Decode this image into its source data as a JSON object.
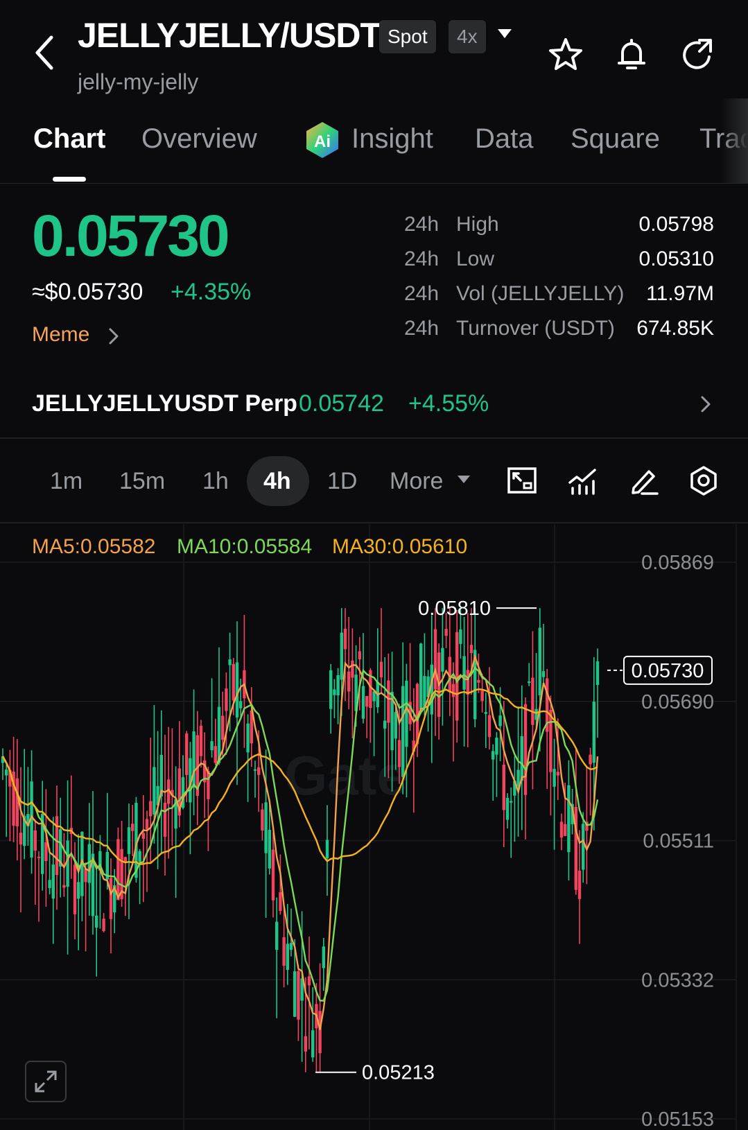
{
  "header": {
    "pair": "JELLYJELLY/USDT",
    "spot_badge": "Spot",
    "leverage_badge": "4x",
    "subtitle": "jelly-my-jelly"
  },
  "tabs": [
    {
      "label": "Chart"
    },
    {
      "label": "Overview"
    },
    {
      "label": "Insight"
    },
    {
      "label": "Data"
    },
    {
      "label": "Square"
    },
    {
      "label": "Trac"
    }
  ],
  "ticker": {
    "price": "0.05730",
    "usd_price": "≈$0.05730",
    "change": "+4.35%",
    "category": "Meme",
    "stats": [
      {
        "period": "24h",
        "label": "High",
        "value": "0.05798"
      },
      {
        "period": "24h",
        "label": "Low",
        "value": "0.05310"
      },
      {
        "period": "24h",
        "label": "Vol (JELLYJELLY)",
        "value": "11.97M"
      },
      {
        "period": "24h",
        "label": "Turnover (USDT)",
        "value": "674.85K"
      }
    ]
  },
  "perp": {
    "name": "JELLYJELLYUSDT Perp",
    "price": "0.05742",
    "change": "+4.55%"
  },
  "intervals": {
    "items": [
      "1m",
      "15m",
      "1h",
      "4h",
      "1D"
    ],
    "active": "4h",
    "more_label": "More"
  },
  "toolbar_icons": [
    "chart-type-icon",
    "indicators-icon",
    "draw-icon",
    "settings-icon"
  ],
  "colors": {
    "up": "#1fc488",
    "down": "#f0445f",
    "ma5": "#f2a24b",
    "ma10": "#7ed957",
    "ma30": "#f5b21b",
    "meme": "#f6a35b"
  },
  "chart_data": {
    "type": "candlestick",
    "indicators": [
      {
        "name": "MA5",
        "label": "MA5:0.05582",
        "value": 0.05582
      },
      {
        "name": "MA10",
        "label": "MA10:0.05584",
        "value": 0.05584
      },
      {
        "name": "MA30",
        "label": "MA30:0.05610",
        "value": 0.0561
      }
    ],
    "y_ticks": [
      "0.05869",
      "0.05690",
      "0.05511",
      "0.05332",
      "0.05153"
    ],
    "ylim": [
      0.05153,
      0.05869
    ],
    "current_price_label": "0.05730",
    "high_marker": "0.05810",
    "low_marker": "0.05213",
    "grid": true,
    "watermark": "Gate"
  }
}
